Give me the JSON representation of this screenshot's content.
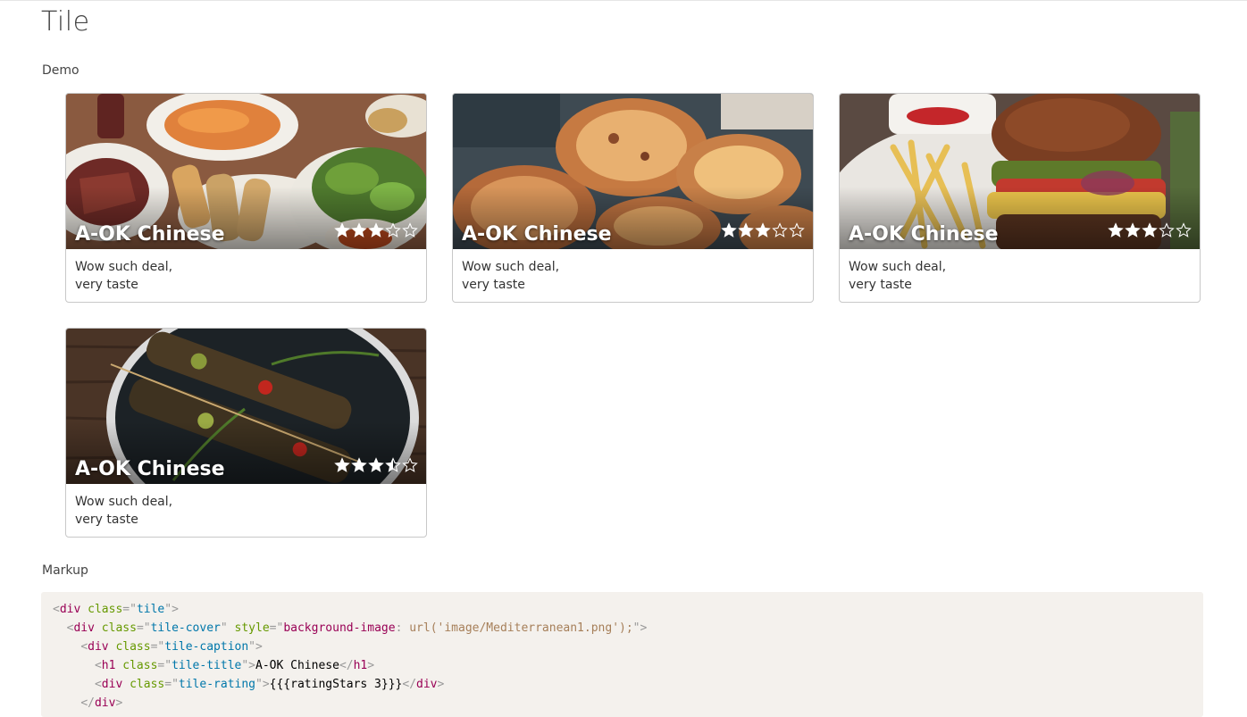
{
  "page": {
    "title": "Tile"
  },
  "sections": {
    "demo": "Demo",
    "markup": "Markup"
  },
  "tiles": [
    {
      "title": "A-OK Chinese",
      "rating": 3,
      "desc_line1": "Wow such deal,",
      "desc_line2": "very taste"
    },
    {
      "title": "A-OK Chinese",
      "rating": 3,
      "desc_line1": "Wow such deal,",
      "desc_line2": "very taste"
    },
    {
      "title": "A-OK Chinese",
      "rating": 3,
      "desc_line1": "Wow such deal,",
      "desc_line2": "very taste"
    },
    {
      "title": "A-OK Chinese",
      "rating": 3.5,
      "desc_line1": "Wow such deal,",
      "desc_line2": "very taste"
    }
  ],
  "code": {
    "line1": {
      "tag": "div",
      "attr": "class",
      "val": "tile"
    },
    "line2": {
      "tag": "div",
      "attr1": "class",
      "val1": "tile-cover",
      "attr2": "style",
      "val2_prop": "background-image",
      "val2_url": "url('image/Mediterranean1.png');"
    },
    "line3": {
      "tag": "div",
      "attr": "class",
      "val": "tile-caption"
    },
    "line4": {
      "tag": "h1",
      "attr": "class",
      "val": "tile-title",
      "text": "A-OK Chinese"
    },
    "line5": {
      "tag": "div",
      "attr": "class",
      "val": "tile-rating",
      "text": "{{{ratingStars 3}}}"
    },
    "line6": {
      "tag": "div"
    }
  },
  "colors": {
    "tag": "#990055",
    "attr": "#669900",
    "value": "#0077aa",
    "url": "#a67f59",
    "code_bg": "#f4f1ed"
  }
}
